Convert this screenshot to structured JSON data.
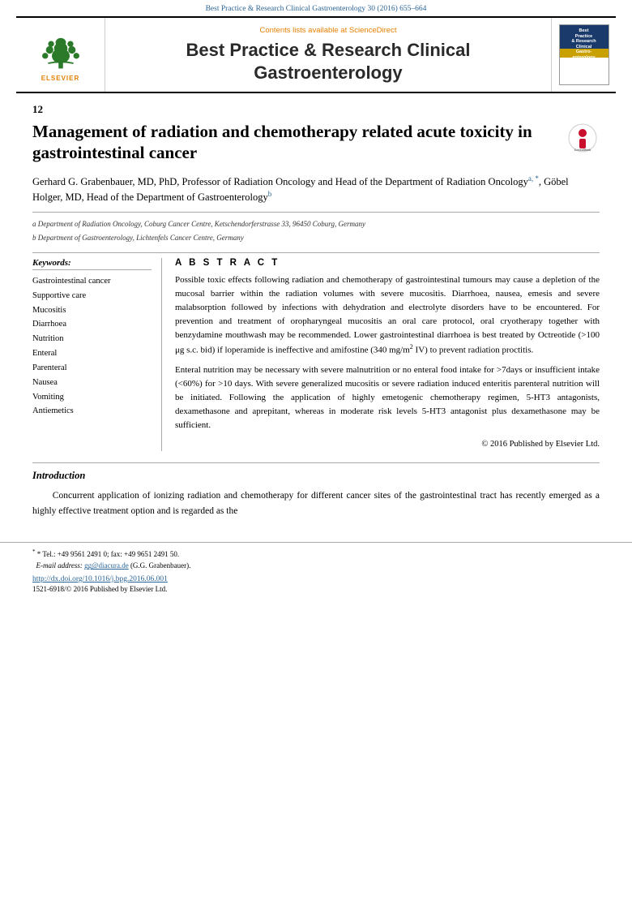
{
  "header": {
    "journal_ref": "Best Practice & Research Clinical Gastroenterology 30 (2016) 655–664",
    "sciencedirect_text": "Contents lists available at",
    "sciencedirect_name": "ScienceDirect",
    "journal_title_line1": "Best Practice & Research Clinical",
    "journal_title_line2": "Gastroenterology",
    "elsevier_label": "ELSEVIER"
  },
  "article": {
    "number": "12",
    "title": "Management of radiation and chemotherapy related acute toxicity in gastrointestinal cancer",
    "authors": "Gerhard G. Grabenbauer, MD, PhD, Professor of Radiation Oncology and Head of the Department of Radiation Oncology",
    "authors_sup1": "a, *",
    "authors_cont": ", Göbel Holger, MD, Head of the Department of Gastroenterology",
    "authors_sup2": "b",
    "affil_a": "a Department of Radiation Oncology, Coburg Cancer Centre, Ketschendorferstrasse 33, 96450 Coburg, Germany",
    "affil_b": "b Department of Gastroenterology, Lichtenfels Cancer Centre, Germany"
  },
  "keywords": {
    "heading": "Keywords:",
    "items": [
      "Gastrointestinal cancer",
      "Supportive care",
      "Mucositis",
      "Diarrhoea",
      "Nutrition",
      "Enteral",
      "Parenteral",
      "Nausea",
      "Vomiting",
      "Antiemetics"
    ]
  },
  "abstract": {
    "heading": "A B S T R A C T",
    "paragraph1": "Possible toxic effects following radiation and chemotherapy of gastrointestinal tumours may cause a depletion of the mucosal barrier within the radiation volumes with severe mucositis. Diarrhoea, nausea, emesis and severe malabsorption followed by infections with dehydration and electrolyte disorders have to be encountered. For prevention and treatment of oropharyngeal mucositis an oral care protocol, oral cryotherapy together with benzydamine mouthwash may be recommended. Lower gastrointestinal diarrhoea is best treated by Octreotide (>100 μg s.c. bid) if loperamide is ineffective and amifostine (340 mg/m² IV) to prevent radiation proctitis.",
    "paragraph2": "Enteral nutrition may be necessary with severe malnutrition or no enteral food intake for >7days or insufficient intake (<60%) for >10 days. With severe generalized mucositis or severe radiation induced enteritis parenteral nutrition will be initiated. Following the application of highly emetogenic chemotherapy regimen, 5-HT3 antagonists, dexamethasone and aprepitant, whereas in moderate risk levels 5-HT3 antagonist plus dexamethasone may be sufficient.",
    "copyright": "© 2016 Published by Elsevier Ltd."
  },
  "introduction": {
    "heading": "Introduction",
    "text": "Concurrent application of ionizing radiation and chemotherapy for different cancer sites of the gastrointestinal tract has recently emerged as a highly effective treatment option and is regarded as the"
  },
  "footer": {
    "footnote_star": "* Tel.: +49 9561 2491 0; fax: +49 9651 2491 50.",
    "email_label": "E-mail address:",
    "email": "gg@diacura.de",
    "email_note": "(G.G. Grabenbauer).",
    "doi_link": "http://dx.doi.org/10.1016/j.bpg.2016.06.001",
    "issn_line": "1521-6918/© 2016 Published by Elsevier Ltd."
  }
}
